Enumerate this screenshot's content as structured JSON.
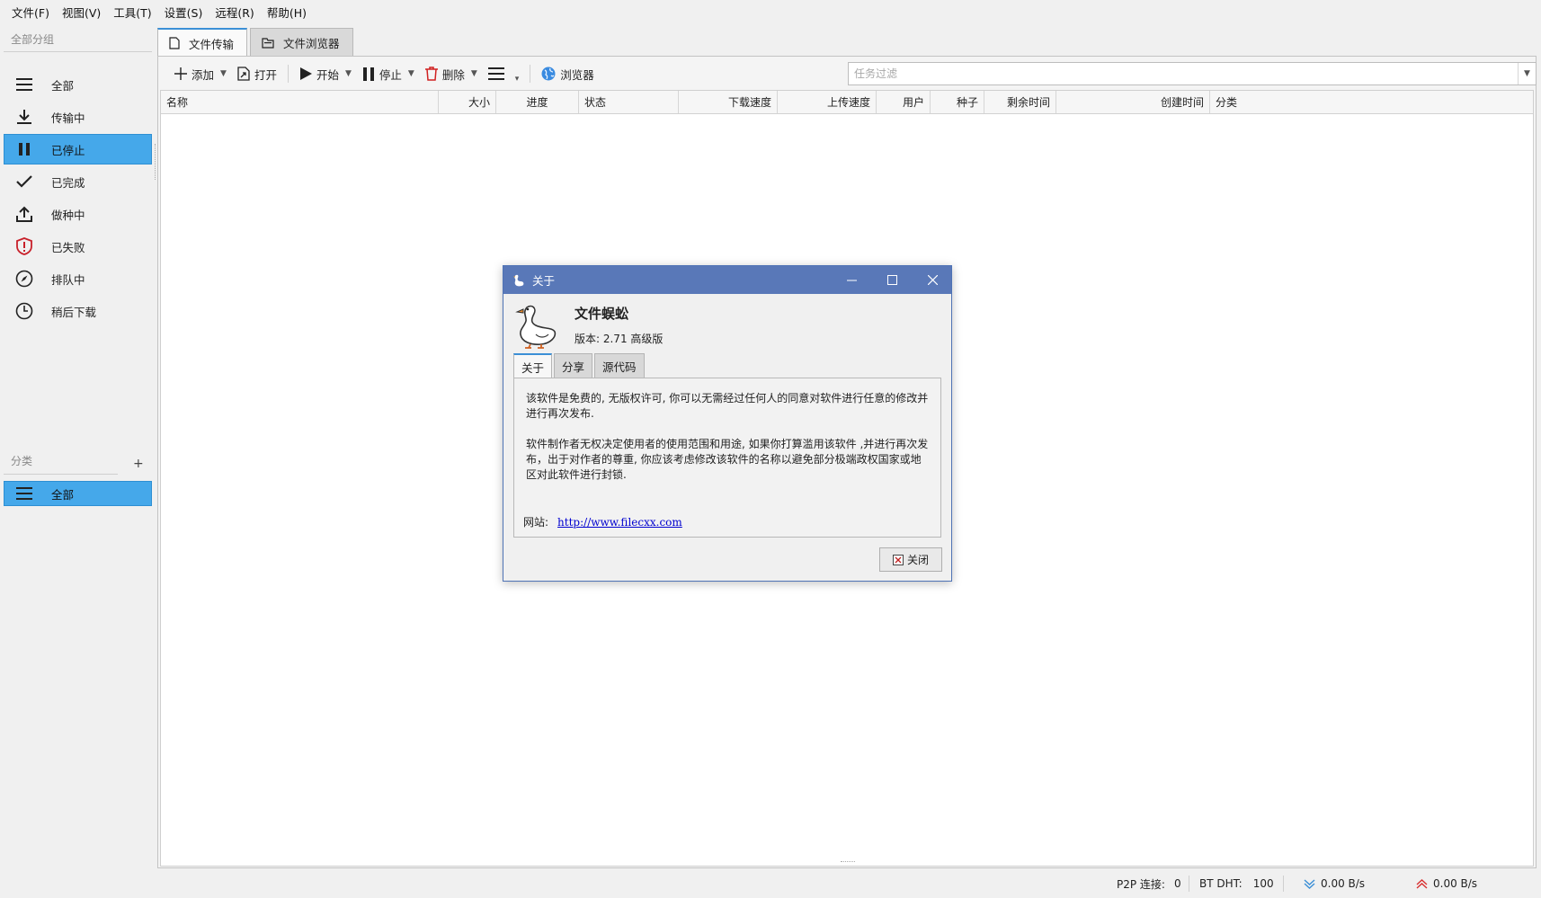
{
  "menu": [
    "文件(F)",
    "视图(V)",
    "工具(T)",
    "设置(S)",
    "远程(R)",
    "帮助(H)"
  ],
  "sidebar": {
    "group_title": "全部分组",
    "items": [
      {
        "label": "全部",
        "icon": "list-icon"
      },
      {
        "label": "传输中",
        "icon": "download-icon"
      },
      {
        "label": "已停止",
        "icon": "pause-icon",
        "active": true
      },
      {
        "label": "已完成",
        "icon": "check-icon"
      },
      {
        "label": "做种中",
        "icon": "upload-icon"
      },
      {
        "label": "已失败",
        "icon": "shield-alert-icon"
      },
      {
        "label": "排队中",
        "icon": "compass-icon"
      },
      {
        "label": "稍后下载",
        "icon": "clock-icon"
      }
    ],
    "category_title": "分类",
    "add_label": "+",
    "categories": [
      {
        "label": "全部",
        "icon": "list-icon",
        "active": true
      }
    ]
  },
  "tabs": [
    {
      "label": "文件传输",
      "icon": "file-icon",
      "active": true
    },
    {
      "label": "文件浏览器",
      "icon": "folder-icon",
      "active": false
    }
  ],
  "toolbar": {
    "add": "添加",
    "open": "打开",
    "start": "开始",
    "stop": "停止",
    "delete": "删除",
    "browser": "浏览器",
    "filter_placeholder": "任务过滤"
  },
  "columns": [
    "名称",
    "大小",
    "进度",
    "状态",
    "下载速度",
    "上传速度",
    "用户",
    "种子",
    "剩余时间",
    "创建时间",
    "分类"
  ],
  "status": {
    "p2p_label": "P2P 连接:",
    "p2p_value": "0",
    "dht_label": "BT DHT:",
    "dht_value": "100",
    "down_speed": "0.00 B/s",
    "up_speed": "0.00 B/s"
  },
  "dialog": {
    "title": "关于",
    "app_name": "文件蜈蚣",
    "version": "版本: 2.71 高级版",
    "tabs": [
      "关于",
      "分享",
      "源代码"
    ],
    "para1": "该软件是免费的, 无版权许可, 你可以无需经过任何人的同意对软件进行任意的修改并进行再次发布.",
    "para2": "软件制作者无权决定使用者的使用范围和用途, 如果你打算滥用该软件 ,并进行再次发布，出于对作者的尊重, 你应该考虑修改该软件的名称以避免部分极端政权国家或地区对此软件进行封锁.",
    "site_label": "网站:",
    "site_url": "http://www.filecxx.com",
    "close": "关闭"
  },
  "colors": {
    "accent": "#45a8ea",
    "dialog_title": "#5978b8",
    "link": "#0000d0"
  }
}
